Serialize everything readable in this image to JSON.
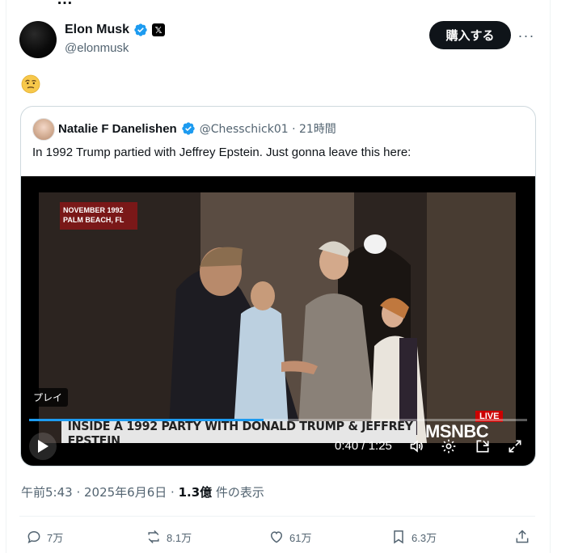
{
  "top_partial_text": "…",
  "author": {
    "name": "Elon Musk",
    "handle": "@elonmusk"
  },
  "buttons": {
    "buy": "購入する",
    "more": "···"
  },
  "tweet_emoji": "🤨",
  "quote": {
    "name": "Natalie F Danelishen",
    "meta": "@Chesschick01 · 21時間",
    "text": "In 1992 Trump partied with Jeffrey Epstein. Just gonna leave this here:"
  },
  "video": {
    "overlay_date_line1": "NOVEMBER 1992",
    "overlay_date_line2": "PALM BEACH, FL",
    "lower_third": "INSIDE A 1992 PARTY WITH DONALD TRUMP & JEFFREY EPSTEIN",
    "network": "MSNBC",
    "live": "LIVE",
    "play_label": "プレイ",
    "time": "0:40 / 1:25",
    "progress": 0.47
  },
  "meta": {
    "time_date": "午前5:43 · 2025年6月6日 · ",
    "views_bold": "1.3億",
    "views_suffix": " 件の表示"
  },
  "actions": {
    "replies": "7万",
    "reposts": "8.1万",
    "likes": "61万",
    "bookmarks": "6.3万"
  },
  "colors": {
    "blue": "#1d9bf0",
    "text_secondary": "#536471",
    "border": "#cfd9de"
  }
}
